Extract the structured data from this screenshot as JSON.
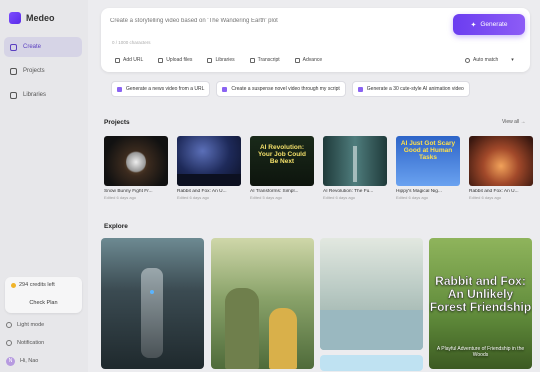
{
  "app": {
    "name": "Medeo"
  },
  "sidebar": {
    "items": [
      {
        "label": "Create",
        "active": true
      },
      {
        "label": "Projects",
        "active": false
      },
      {
        "label": "Libraries",
        "active": false
      }
    ],
    "credits": {
      "text": "294 credits left",
      "button": "Check Plan"
    },
    "bottom": {
      "light_mode": "Light mode",
      "notification": "Notification",
      "user": "Hi, Nao",
      "avatar_initial": "N"
    }
  },
  "prompt": {
    "placeholder": "Create a storytelling video based on 'The Wandering Earth' plot",
    "char_count": "0 / 1000 characters",
    "generate": "Generate",
    "tools": [
      "Add URL",
      "Upload files",
      "Libraries",
      "Transcript",
      "Advance"
    ],
    "auto_match": "Auto match"
  },
  "suggestions": [
    "Generate a news video from a URL",
    "Create a suspense novel video through my script",
    "Generate a 30 cute-style AI animation video"
  ],
  "projects": {
    "title": "Projects",
    "view_all": "View all",
    "items": [
      {
        "title": "Snow Bunny Fight Fr...",
        "date": "Edited 6 days ago"
      },
      {
        "title": "Rabbit and Fox: An U...",
        "date": "Edited 6 days ago"
      },
      {
        "title": "AI Transforms: Simpl...",
        "date": "Edited 5 days ago",
        "overlay": "AI Revolution: Your Job Could Be Next"
      },
      {
        "title": "AI Revolution: The Fu...",
        "date": "Edited 6 days ago"
      },
      {
        "title": "Hippy's Magical Nig...",
        "date": "Edited 6 days ago",
        "overlay": "AI Just Got Scary Good at Human Tasks"
      },
      {
        "title": "Rabbit and Fox: An U...",
        "date": "Edited 6 days ago"
      }
    ]
  },
  "explore": {
    "title": "Explore",
    "cards": [
      {
        "label": "robot"
      },
      {
        "label": "grandfather"
      },
      {
        "label": "pond"
      },
      {
        "label": "rabbit-fox",
        "overlay": "Rabbit and Fox: An Unlikely Forest Friendship",
        "sub": "A Playful Adventure of Friendship in the Woods"
      }
    ]
  },
  "colors": {
    "accent": "#6b3df0",
    "active_nav": "#d6d4e6"
  },
  "icons": [
    "logo-icon",
    "create-icon",
    "projects-icon",
    "libraries-icon",
    "sun-icon",
    "bell-icon",
    "sparkle-icon",
    "link-icon",
    "upload-icon",
    "library-icon",
    "transcript-icon",
    "advance-icon",
    "chevron-down-icon"
  ]
}
